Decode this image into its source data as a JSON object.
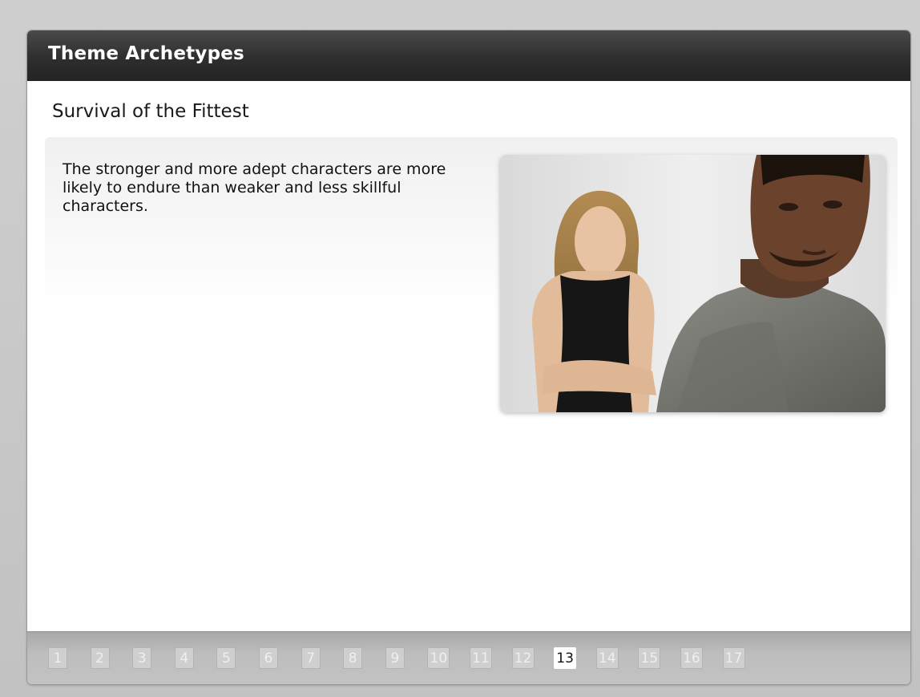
{
  "header": {
    "title": "Theme Archetypes"
  },
  "slide": {
    "subtitle": "Survival of the Fittest",
    "body": "The stronger and more adept characters are more likely to endure than weaker and less skillful characters.",
    "image_description": "photo-woman-and-man"
  },
  "pager": {
    "current": "13",
    "pages": [
      "1",
      "2",
      "3",
      "4",
      "5",
      "6",
      "7",
      "8",
      "9",
      "10",
      "11",
      "12",
      "13",
      "14",
      "15",
      "16",
      "17"
    ]
  },
  "colors": {
    "header_bg": "#2e2e2e",
    "footer_bg": "#bdbdbd",
    "active_page_bg": "#ffffff",
    "inactive_page_bg": "#cfcfcf"
  }
}
